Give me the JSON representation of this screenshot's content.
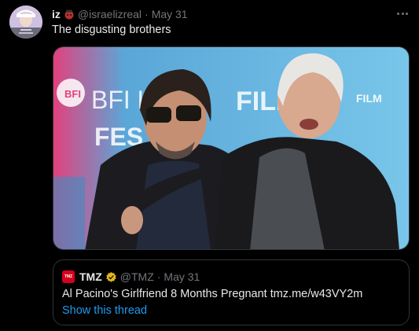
{
  "tweet": {
    "author_name": "iz",
    "emoji_icon": "tomato-head-emoji",
    "handle": "@israelizreal",
    "separator": "·",
    "date": "May 31",
    "text": "The disgusting brothers",
    "more_icon": "ellipsis-icon"
  },
  "media": {
    "backdrop_words": [
      "BFI",
      "FILM",
      "FES"
    ],
    "backdrop_colors": {
      "pink": "#e2417d",
      "blue": "#4ea7d6",
      "light_blue": "#79c6ea"
    }
  },
  "quote": {
    "logo_text": "TMZ",
    "name": "TMZ",
    "verified_icon": "gold-verified-badge",
    "handle": "@TMZ",
    "separator": "·",
    "date": "May 31",
    "text": "Al Pacino's Girlfriend 8 Months Pregnant tmz.me/w43VY2m",
    "thread_link": "Show this thread"
  },
  "colors": {
    "background": "#000000",
    "text": "#e7e9ea",
    "muted": "#71767b",
    "link": "#1d9bf0",
    "border": "#2f3336",
    "verified_gold": "#e2b719"
  }
}
